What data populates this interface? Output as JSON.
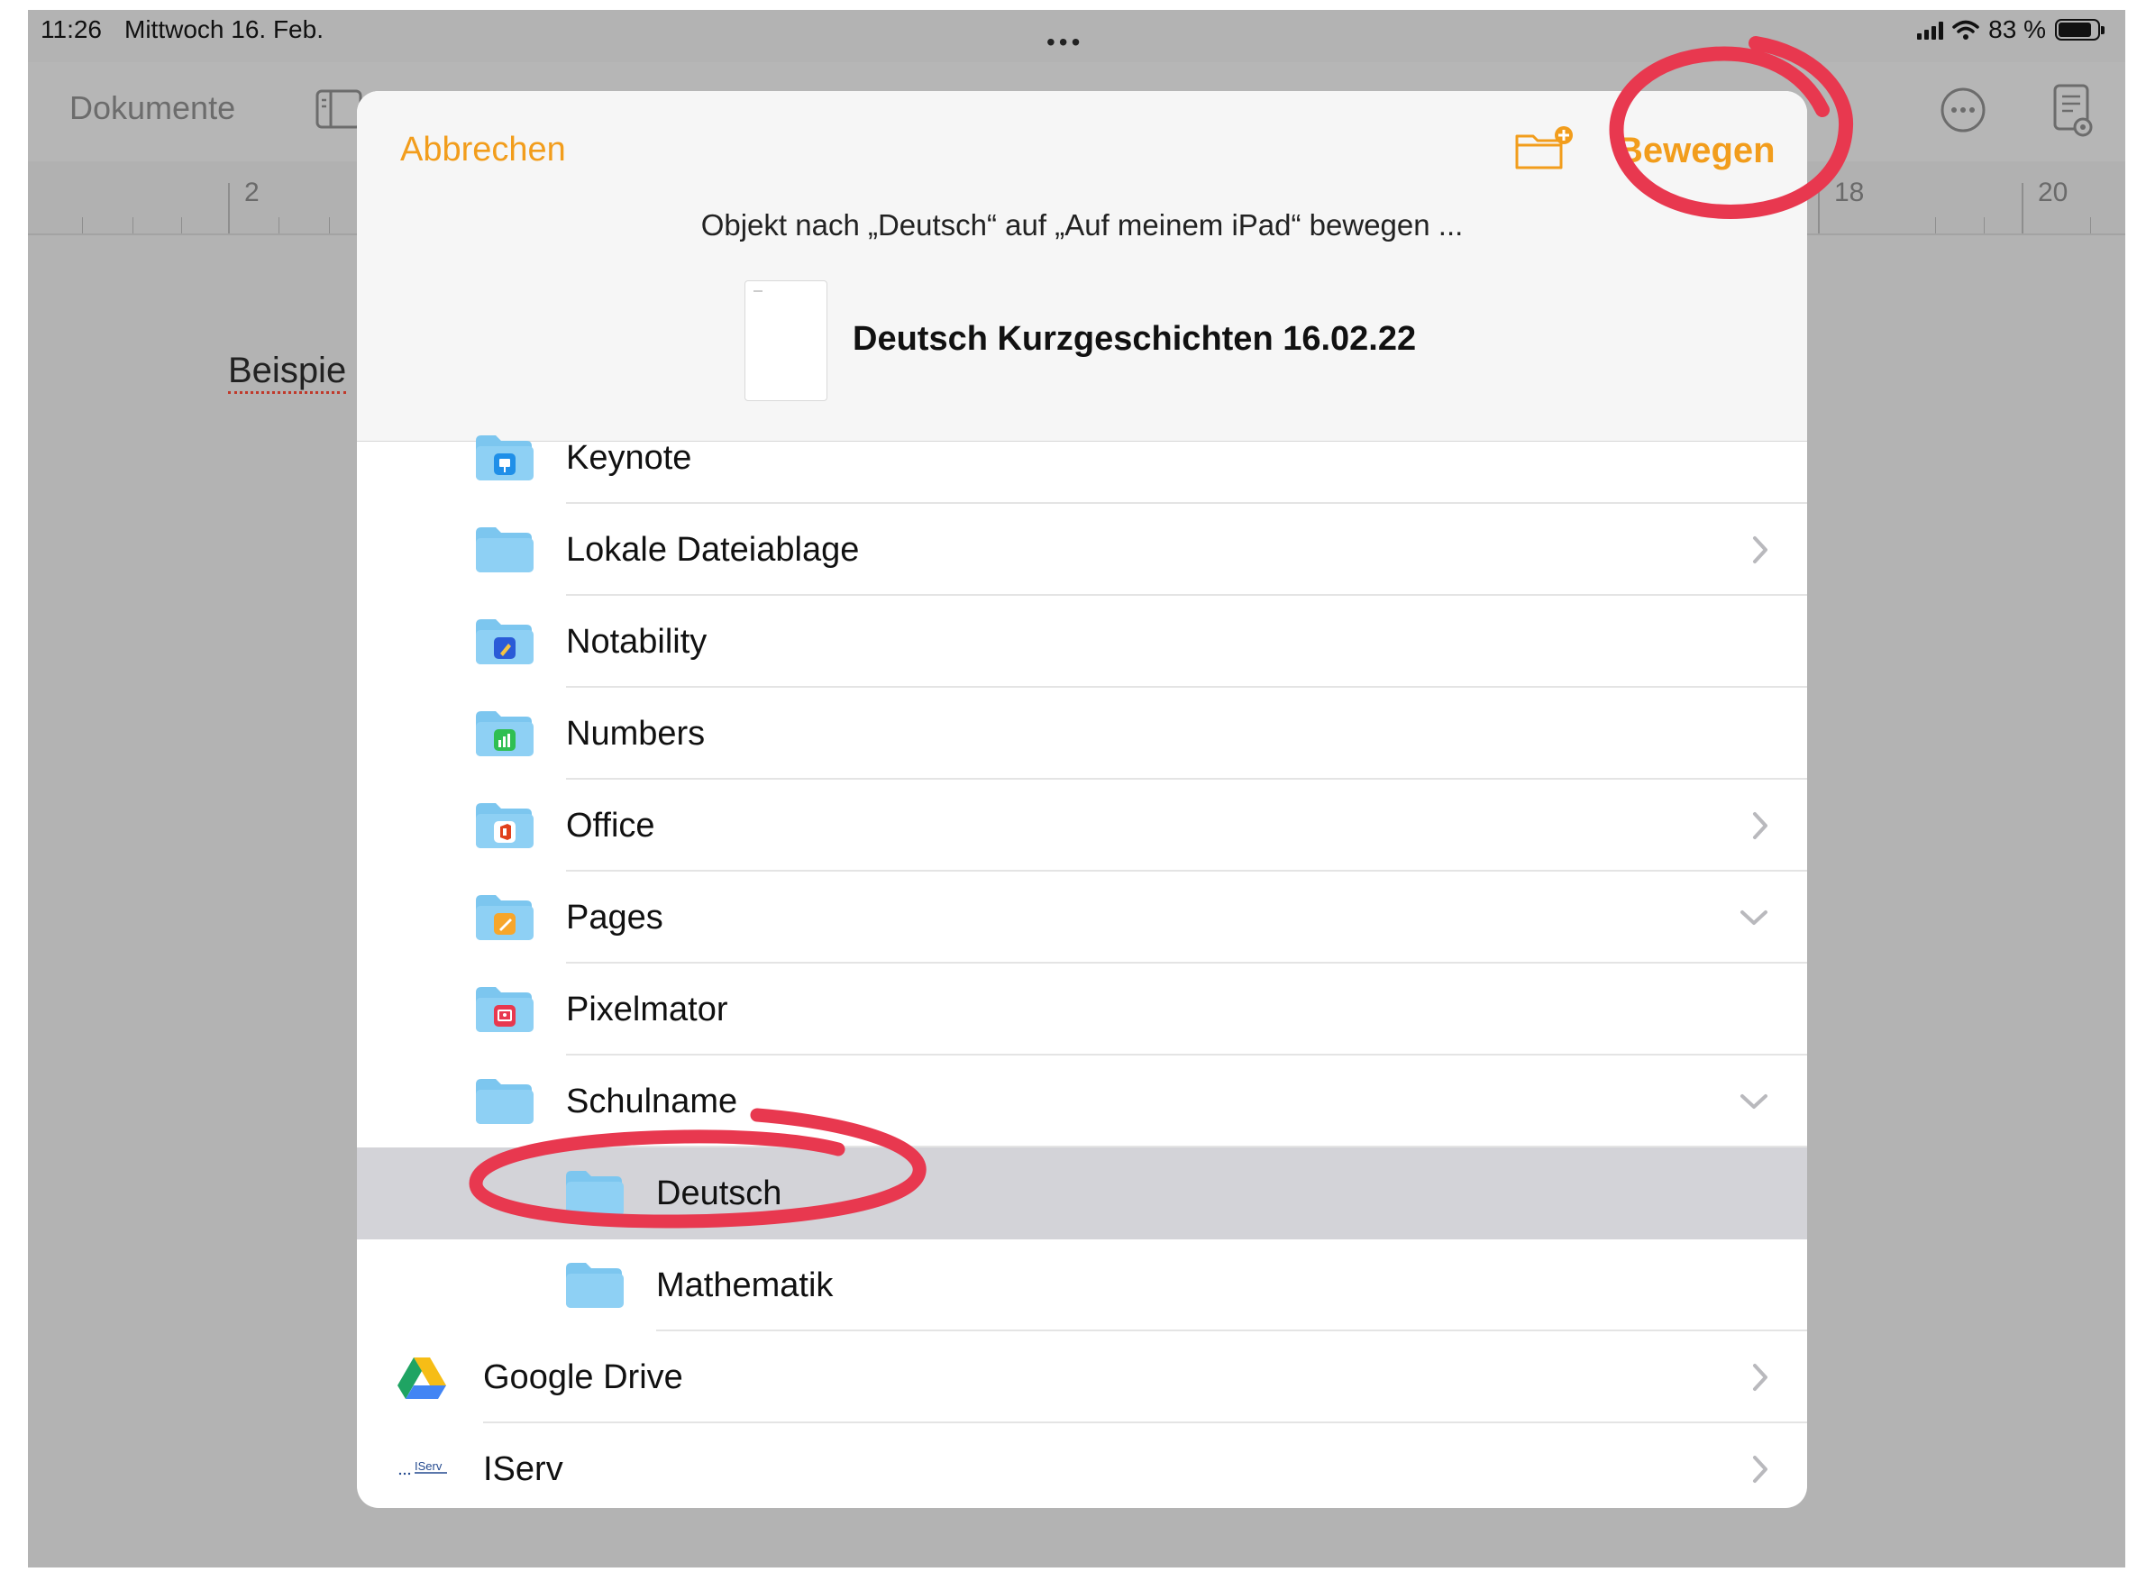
{
  "status_bar": {
    "time": "11:26",
    "date": "Mittwoch 16. Feb.",
    "battery": "83 %",
    "dots": "•••"
  },
  "toolbar": {
    "documents_label": "Dokumente",
    "icons": [
      "sidebar-icon",
      "list-icon",
      "more-icon",
      "view-icon"
    ]
  },
  "ruler": {
    "numbers": [
      "2",
      "18",
      "20"
    ]
  },
  "document": {
    "visible_text": "Beispie"
  },
  "sheet": {
    "cancel_label": "Abbrechen",
    "move_label": "Bewegen",
    "subtitle": "Objekt nach „Deutsch“ auf „Auf meinem iPad“ bewegen ...",
    "file_name": "Deutsch Kurzgeschichten 16.02.22"
  },
  "folders": [
    {
      "label": "Keynote",
      "icon": "keynote-folder-icon",
      "chevron": "none"
    },
    {
      "label": "Lokale Dateiablage",
      "icon": "folder-icon",
      "chevron": "right"
    },
    {
      "label": "Notability",
      "icon": "notability-folder-icon",
      "chevron": "none"
    },
    {
      "label": "Numbers",
      "icon": "numbers-folder-icon",
      "chevron": "none"
    },
    {
      "label": "Office",
      "icon": "office-folder-icon",
      "chevron": "right"
    },
    {
      "label": "Pages",
      "icon": "pages-folder-icon",
      "chevron": "down"
    },
    {
      "label": "Pixelmator",
      "icon": "pixelmator-folder-icon",
      "chevron": "none"
    },
    {
      "label": "Schulname",
      "icon": "folder-icon",
      "chevron": "down"
    },
    {
      "label": "Deutsch",
      "icon": "folder-icon",
      "chevron": "none",
      "selected": true
    },
    {
      "label": "Mathematik",
      "icon": "folder-icon",
      "chevron": "none"
    },
    {
      "label": "Google Drive",
      "icon": "google-drive-icon",
      "chevron": "right"
    },
    {
      "label": "IServ",
      "icon": "iserv-icon",
      "chevron": "right",
      "icon_text": "IServ"
    }
  ],
  "colors": {
    "accent": "#f29d1c",
    "annotation": "#e8384f",
    "selection": "#d3d3d8",
    "folder": "#8ed0f4"
  }
}
